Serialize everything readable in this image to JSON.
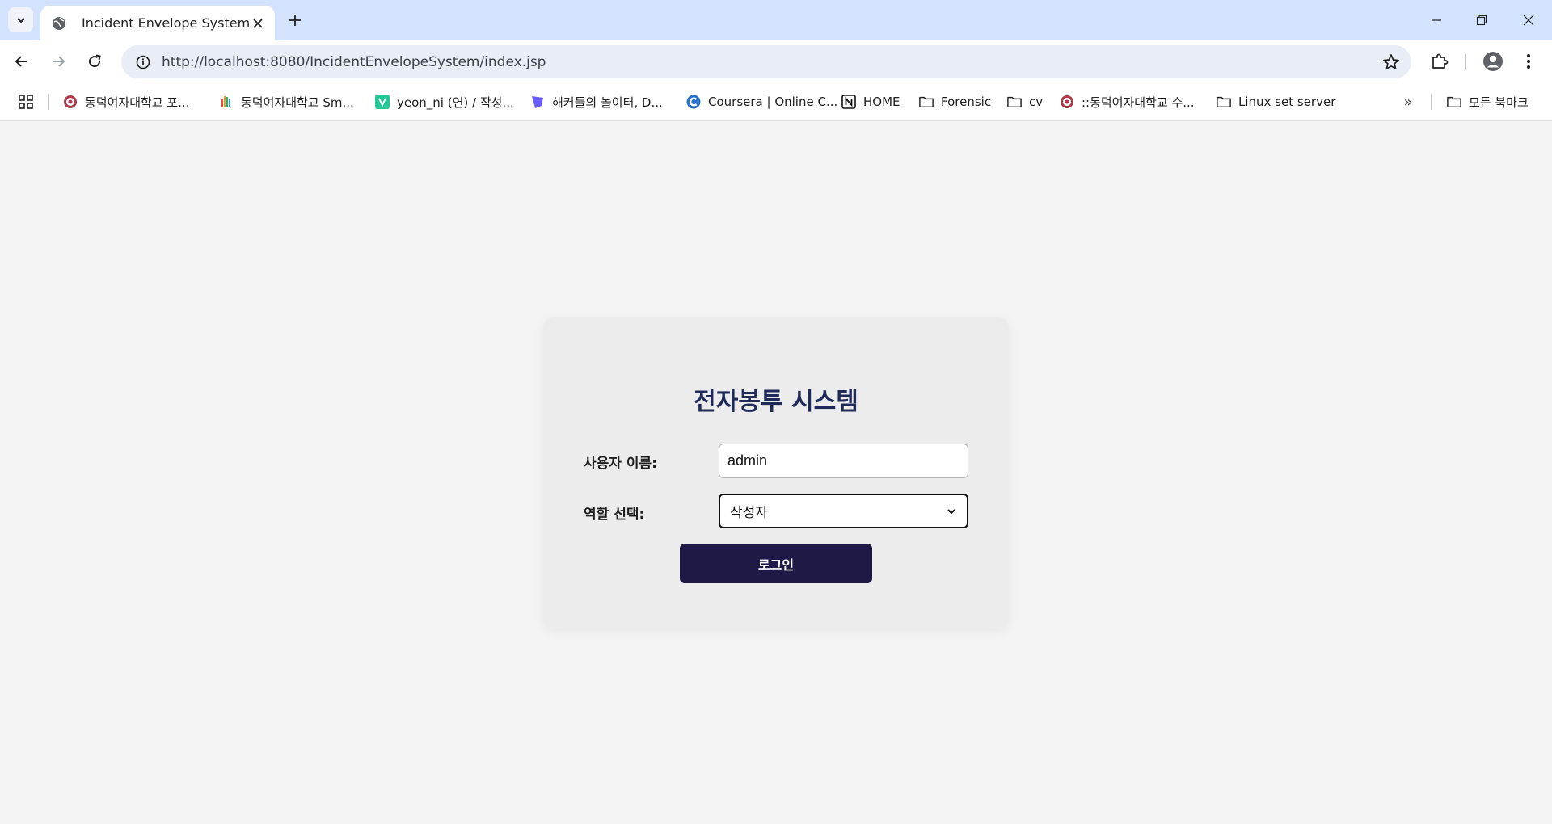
{
  "browser": {
    "tab": {
      "title": "Incident Envelope System"
    },
    "url": "http://localhost:8080/IncidentEnvelopeSystem/index.jsp",
    "accent_color": "#d3e3fd",
    "bookmarks": [
      {
        "label": "동덕여자대학교 포...",
        "icon": "university-seal-icon"
      },
      {
        "label": "동덕여자대학교 Sm...",
        "icon": "colorful-hand-icon"
      },
      {
        "label": "yeon_ni (연) / 작성...",
        "icon": "velog-icon"
      },
      {
        "label": "해커들의 놀이터, D...",
        "icon": "dreamhack-icon"
      },
      {
        "label": "Coursera | Online C...",
        "icon": "coursera-icon"
      },
      {
        "label": "HOME",
        "icon": "notion-icon"
      },
      {
        "label": "Forensic",
        "icon": "folder-icon"
      },
      {
        "label": "cv",
        "icon": "folder-icon"
      },
      {
        "label": "::동덕여자대학교 수...",
        "icon": "university-seal-icon"
      },
      {
        "label": "Linux set server",
        "icon": "folder-icon"
      }
    ],
    "all_bookmarks_label": "모든 북마크"
  },
  "login": {
    "title": "전자봉투 시스템",
    "username_label": "사용자 이름:",
    "username_value": "admin",
    "role_label": "역할 선택:",
    "role_value": "작성자",
    "submit_label": "로그인",
    "title_color": "#1f2a5a",
    "button_color": "#1e1a45"
  }
}
